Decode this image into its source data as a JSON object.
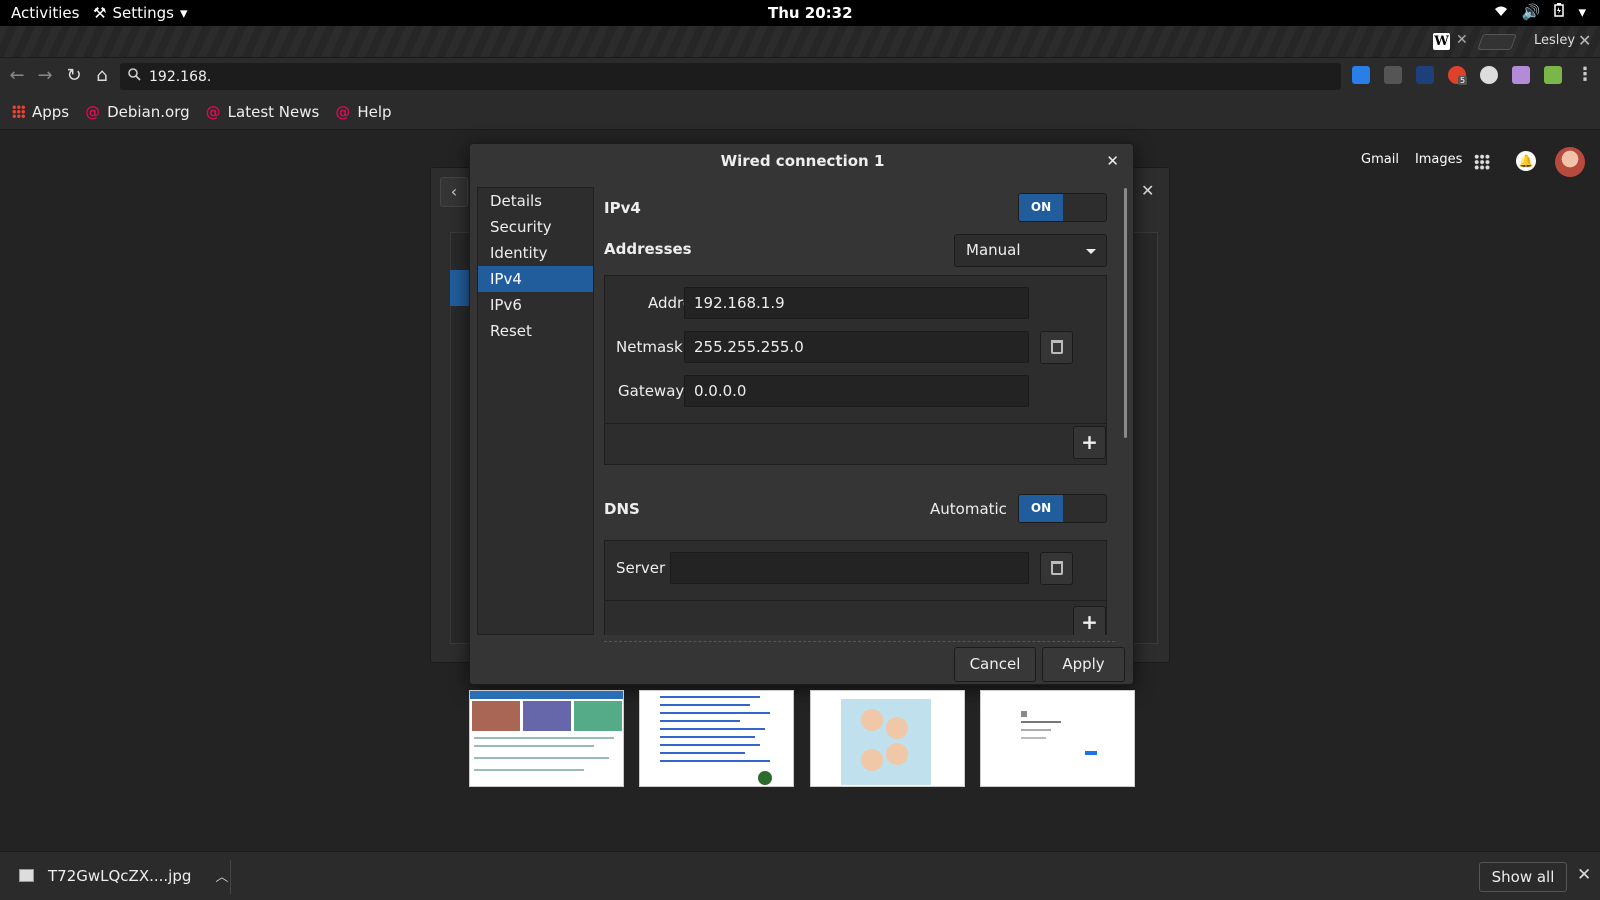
{
  "topbar": {
    "activities": "Activities",
    "app_menu": "Settings",
    "clock": "Thu 20:32"
  },
  "browser": {
    "tab_favicon": "W",
    "profile_name": "Lesley",
    "omnibox_value": "192.168.",
    "bookmarks": [
      "Apps",
      "Debian.org",
      "Latest News",
      "Help"
    ],
    "extension_badge": "5"
  },
  "google": {
    "links": [
      "Gmail",
      "Images"
    ]
  },
  "dialog": {
    "title": "Wired connection 1",
    "sidebar": [
      {
        "label": "Details",
        "selected": false
      },
      {
        "label": "Security",
        "selected": false
      },
      {
        "label": "Identity",
        "selected": false
      },
      {
        "label": "IPv4",
        "selected": true
      },
      {
        "label": "IPv6",
        "selected": false
      },
      {
        "label": "Reset",
        "selected": false
      }
    ],
    "ipv4": {
      "heading": "IPv4",
      "toggle": "ON",
      "addresses_label": "Addresses",
      "method": "Manual",
      "address_label": "Address",
      "address_value": "192.168.1.9",
      "netmask_label": "Netmask",
      "netmask_value": "255.255.255.0",
      "gateway_label": "Gateway",
      "gateway_value": "0.0.0.0"
    },
    "dns": {
      "heading": "DNS",
      "automatic_label": "Automatic",
      "toggle": "ON",
      "server_label": "Server",
      "server_value": ""
    },
    "buttons": {
      "cancel": "Cancel",
      "apply": "Apply"
    }
  },
  "downloads": {
    "file_name": "T72GwLQcZX....jpg",
    "show_all": "Show all"
  },
  "colors": {
    "accent": "#215d9c",
    "dialog_bg": "#353535",
    "page_bg": "#232323"
  }
}
